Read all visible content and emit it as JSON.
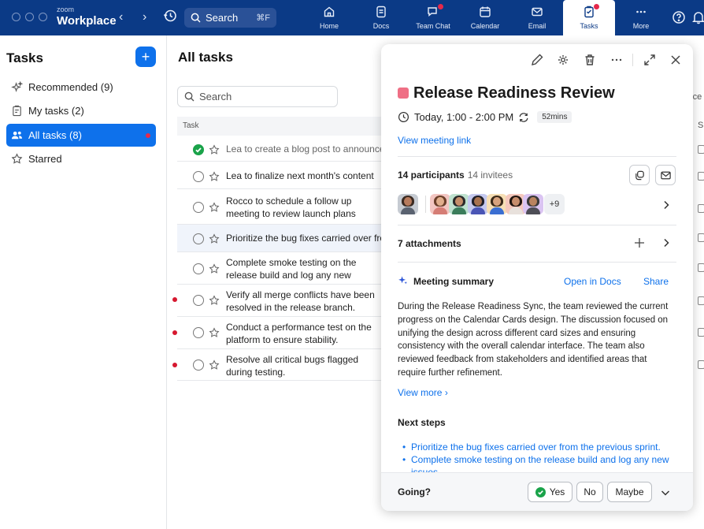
{
  "window": {
    "brand_small": "zoom",
    "brand_name": "Workplace",
    "search_label": "Search",
    "search_shortcut": "⌘F"
  },
  "apps": [
    {
      "label": "Home",
      "icon": "home-icon",
      "active": false,
      "badge": false
    },
    {
      "label": "Docs",
      "icon": "docs-icon",
      "active": false,
      "badge": false
    },
    {
      "label": "Team Chat",
      "icon": "chat-icon",
      "active": false,
      "badge": true
    },
    {
      "label": "Calendar",
      "icon": "calendar-icon",
      "active": false,
      "badge": false
    },
    {
      "label": "Email",
      "icon": "email-icon",
      "active": false,
      "badge": false
    },
    {
      "label": "Tasks",
      "icon": "tasks-icon",
      "active": true,
      "badge": true
    },
    {
      "label": "More",
      "icon": "more-icon",
      "active": false,
      "badge": false
    }
  ],
  "sidebar": {
    "title": "Tasks",
    "add_label": "+",
    "items": [
      {
        "label": "Recommended (9)",
        "icon": "sparkle-icon",
        "active": false,
        "badge": false
      },
      {
        "label": "My tasks (2)",
        "icon": "clipboard-icon",
        "active": false,
        "badge": false
      },
      {
        "label": "All tasks (8)",
        "icon": "people-icon",
        "active": true,
        "badge": true
      },
      {
        "label": "Starred",
        "icon": "star-icon",
        "active": false,
        "badge": false
      }
    ]
  },
  "main": {
    "title": "All tasks",
    "search_placeholder": "Search",
    "column_task": "Task",
    "edge_text": "rce",
    "edge_head": "S",
    "tasks": [
      {
        "text": "Lea to create a blog post to announce",
        "done": true,
        "starred": false,
        "unread": false,
        "selected": false
      },
      {
        "text": "Lea to finalize next month's content",
        "done": false,
        "starred": false,
        "unread": false,
        "selected": false
      },
      {
        "text": "Rocco to schedule a follow up meeting to review launch plans",
        "done": false,
        "starred": false,
        "unread": false,
        "selected": false
      },
      {
        "text": "Prioritize the bug fixes carried over from",
        "done": false,
        "starred": false,
        "unread": false,
        "selected": true
      },
      {
        "text": "Complete smoke testing on the release build and log any new issues.",
        "done": false,
        "starred": false,
        "unread": false,
        "selected": false
      },
      {
        "text": "Verify all merge conflicts have been resolved in the release branch.",
        "done": false,
        "starred": false,
        "unread": true,
        "selected": false
      },
      {
        "text": "Conduct a performance test on the platform to ensure stability.",
        "done": false,
        "starred": false,
        "unread": true,
        "selected": false
      },
      {
        "text": "Resolve all critical bugs flagged during testing.",
        "done": false,
        "starred": false,
        "unread": true,
        "selected": false
      }
    ]
  },
  "panel": {
    "title": "Release Readiness Review",
    "title_color": "#ef6f85",
    "time": "Today, 1:00 - 2:00 PM",
    "duration": "52mins",
    "meeting_link": "View meeting link",
    "participants_label": "14 participants",
    "invitees_label": "14 invitees",
    "more_participants": "+9",
    "attachments_label": "7 attachments",
    "summary_title": "Meeting summary",
    "open_in_docs": "Open in Docs",
    "share": "Share",
    "summary_text": "During the Release Readiness Sync, the team reviewed the current progress on the Calendar Cards design. The discussion focused on unifying the design across different card sizes and ensuring consistency with the overall calendar interface. The team also reviewed feedback from stakeholders and identified areas that require further refinement.",
    "view_more": "View more",
    "next_steps_title": "Next steps",
    "next_steps": [
      "Prioritize the bug fixes carried over from the previous sprint.",
      "Complete smoke testing on the release build and log any new issues."
    ],
    "going_label": "Going?",
    "rsvp_yes": "Yes",
    "rsvp_no": "No",
    "rsvp_maybe": "Maybe"
  },
  "colors": {
    "topbar": "#0b3a86",
    "accent": "#0e71eb",
    "badge": "#e5294b",
    "done": "#1aa34a"
  }
}
